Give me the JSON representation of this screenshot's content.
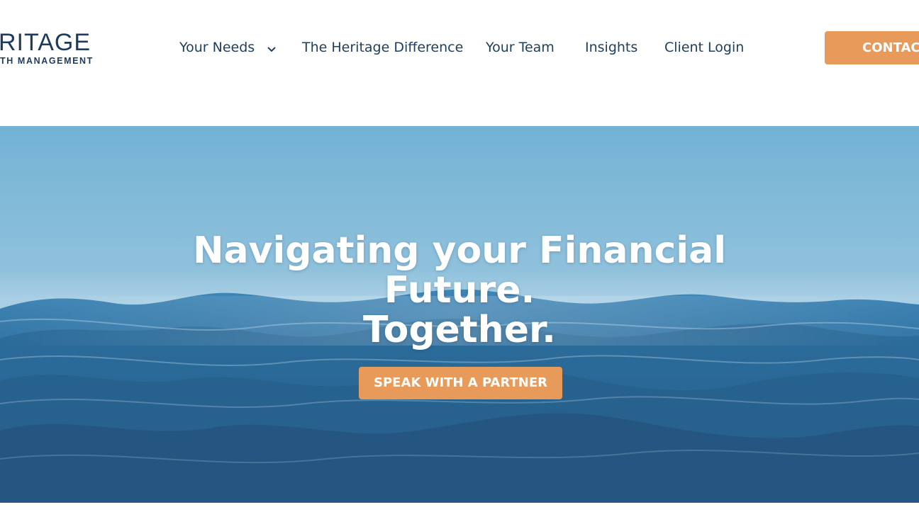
{
  "logo": {
    "name": "RITAGE",
    "tagline": "TH MANAGEMENT"
  },
  "nav": {
    "items": [
      {
        "label": "Your Needs",
        "has_dropdown": true
      },
      {
        "label": "The Heritage Difference"
      },
      {
        "label": "Your Team"
      },
      {
        "label": "Insights"
      },
      {
        "label": "Client Login"
      }
    ],
    "contact_label": "CONTAC"
  },
  "hero": {
    "title_line1": "Navigating your Financial",
    "title_line2": "Future.",
    "title_line3": "Together.",
    "cta_label": "SPEAK WITH A PARTNER"
  },
  "colors": {
    "brand_navy": "#1d3b5e",
    "accent_orange": "#e79a59",
    "sky_blue": "#73b2d4",
    "ocean_blue": "#2e6f9e"
  },
  "icons": {
    "dropdown": "chevron-down-icon"
  }
}
